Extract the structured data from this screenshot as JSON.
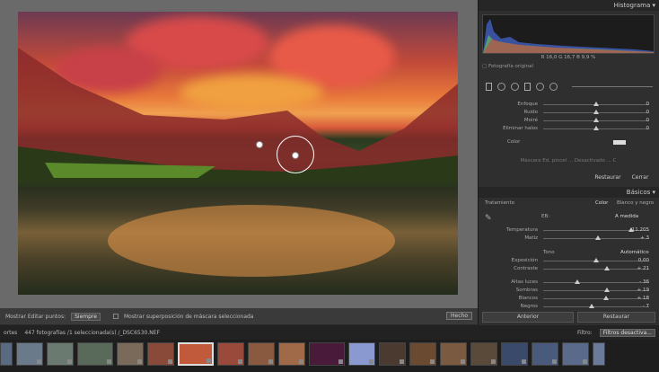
{
  "toolbar": {
    "show_pins_label": "Mostrar Editar puntos:",
    "show_pins_value": "Siempre",
    "overlay_label": "Mostrar superposición de máscara seleccionada",
    "done_label": "Hecho"
  },
  "panel": {
    "histogram_title": "Histograma",
    "histogram_info": "R 16,0   G 16,7   B 9,9 %",
    "original_photo": "Fotografía original",
    "mask_rows": [
      {
        "label": "Enfoque",
        "value": "0",
        "pos": 0.5
      },
      {
        "label": "Ruido",
        "value": "0",
        "pos": 0.5
      },
      {
        "label": "Moiré",
        "value": "0",
        "pos": 0.5
      },
      {
        "label": "Eliminar halos",
        "value": "0",
        "pos": 0.5
      }
    ],
    "color_label": "Color",
    "mask_effect_text": "Máscara Ed. pincel ... Desactivado ... C",
    "reset_button": "Restaurar",
    "close_button": "Cerrar",
    "basics_title": "Básicos",
    "treatment_label": "Tratamiento",
    "treatment_color": "Color",
    "treatment_bw": "Blanco y negro",
    "wb_label": "EB:",
    "wb_value": "A medida",
    "wb_rows": [
      {
        "label": "Temperatura",
        "value": "11.205",
        "pos": 0.83
      },
      {
        "label": "Matiz",
        "value": "+ 3",
        "pos": 0.52
      }
    ],
    "tone_label": "Tono",
    "tone_auto": "Automático",
    "tone_rows": [
      {
        "label": "Exposición",
        "value": "0,00",
        "pos": 0.5
      },
      {
        "label": "Contraste",
        "value": "+ 21",
        "pos": 0.6
      }
    ],
    "presence_rows": [
      {
        "label": "Altas luces",
        "value": "- 36",
        "pos": 0.32
      },
      {
        "label": "Sombras",
        "value": "+ 19",
        "pos": 0.6
      },
      {
        "label": "Blancos",
        "value": "+ 18",
        "pos": 0.59
      },
      {
        "label": "Negros",
        "value": "- 7",
        "pos": 0.46
      }
    ],
    "previous_button": "Anterior",
    "restore_button": "Restaurar"
  },
  "filmstrip": {
    "left_label": "ortes",
    "info": "447 fotografías /1 seleccionada(s) /_DSC6530.NEF",
    "filter_label": "Filtro:",
    "filter_value": "Filtros desactiva..."
  },
  "colors": {
    "accent": "#3a78d0",
    "panel": "#2f2f2f",
    "photo_frame": "#6a6a6a"
  }
}
